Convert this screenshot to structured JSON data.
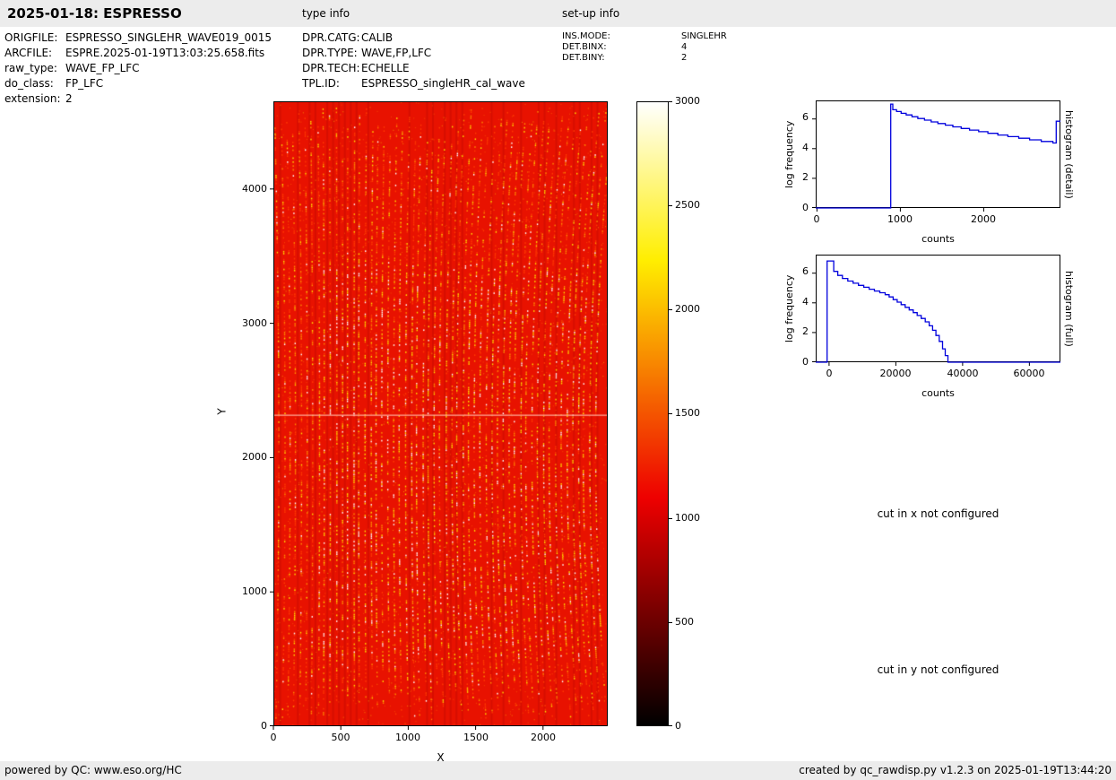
{
  "header": {
    "title": "2025-01-18: ESPRESSO",
    "type_info_label": "type info",
    "setup_info_label": "set-up info"
  },
  "file_info": {
    "rows": [
      {
        "label": "ORIGFILE:",
        "value": "ESPRESSO_SINGLEHR_WAVE019_0015"
      },
      {
        "label": "ARCFILE:",
        "value": "ESPRE.2025-01-19T13:03:25.658.fits"
      },
      {
        "label": "raw_type:",
        "value": "WAVE_FP_LFC"
      },
      {
        "label": "do_class:",
        "value": "FP_LFC"
      },
      {
        "label": "extension:",
        "value": "2"
      }
    ]
  },
  "type_info": {
    "rows": [
      {
        "label": "DPR.CATG:",
        "value": "CALIB"
      },
      {
        "label": "DPR.TYPE:",
        "value": "WAVE,FP,LFC"
      },
      {
        "label": "DPR.TECH:",
        "value": "ECHELLE"
      },
      {
        "label": "TPL.ID:",
        "value": "ESPRESSO_singleHR_cal_wave"
      }
    ]
  },
  "setup_info": {
    "rows": [
      {
        "label": "INS.MODE:",
        "value": "SINGLEHR"
      },
      {
        "label": "DET.BINX:",
        "value": "4"
      },
      {
        "label": "DET.BINY:",
        "value": "2"
      }
    ]
  },
  "annotations": {
    "cut_x": "cut in x not configured",
    "cut_y": "cut in y not configured"
  },
  "footer": {
    "left": "powered by QC: www.eso.org/HC",
    "right": "created by qc_rawdisp.py v1.2.3 on 2025-01-19T13:44:20"
  },
  "chart_data": [
    {
      "id": "raw_image",
      "type": "heatmap",
      "title": "",
      "xlabel": "X",
      "ylabel": "Y",
      "xlim": [
        0,
        2480
      ],
      "ylim": [
        0,
        4653
      ],
      "xticks": [
        0,
        500,
        1000,
        1500,
        2000
      ],
      "yticks": [
        0,
        1000,
        2000,
        3000,
        4000
      ],
      "colormap": "hot",
      "base_color": "#e81200",
      "features": {
        "background": "saturated red detector frame",
        "pattern": "dense vertical echelle-order columns of bright FP/LFC emission-line dots",
        "horizontal_line_y": 2320
      },
      "colorbar": {
        "lim": [
          0,
          3000
        ],
        "ticks": [
          0,
          500,
          1000,
          1500,
          2000,
          2500,
          3000
        ],
        "gradient_colors": [
          "#000000",
          "#ee0000",
          "#ffee00",
          "#ffffff"
        ],
        "gradient_stops_pct": [
          0,
          36.5,
          74.6,
          100
        ]
      }
    },
    {
      "id": "hist_detail",
      "type": "line",
      "line_color": "#0000dd",
      "xlabel": "counts",
      "ylabel": "log frequency",
      "right_label": "histogram (detail)",
      "xlim": [
        -15,
        2920
      ],
      "ylim": [
        0,
        7.25
      ],
      "xticks": [
        0,
        1000,
        2000
      ],
      "yticks": [
        0,
        2,
        4,
        6
      ],
      "grid": false,
      "points": [
        [
          -15,
          0
        ],
        [
          885,
          0
        ],
        [
          885,
          7.0
        ],
        [
          910,
          7.0
        ],
        [
          910,
          6.62
        ],
        [
          955,
          6.62
        ],
        [
          955,
          6.5
        ],
        [
          1010,
          6.5
        ],
        [
          1010,
          6.38
        ],
        [
          1070,
          6.38
        ],
        [
          1070,
          6.27
        ],
        [
          1140,
          6.27
        ],
        [
          1140,
          6.15
        ],
        [
          1210,
          6.15
        ],
        [
          1210,
          6.03
        ],
        [
          1290,
          6.03
        ],
        [
          1290,
          5.92
        ],
        [
          1370,
          5.92
        ],
        [
          1370,
          5.8
        ],
        [
          1450,
          5.8
        ],
        [
          1450,
          5.69
        ],
        [
          1540,
          5.69
        ],
        [
          1540,
          5.58
        ],
        [
          1630,
          5.58
        ],
        [
          1630,
          5.47
        ],
        [
          1730,
          5.47
        ],
        [
          1730,
          5.36
        ],
        [
          1830,
          5.36
        ],
        [
          1830,
          5.25
        ],
        [
          1940,
          5.25
        ],
        [
          1940,
          5.14
        ],
        [
          2050,
          5.14
        ],
        [
          2050,
          5.03
        ],
        [
          2170,
          5.03
        ],
        [
          2170,
          4.92
        ],
        [
          2290,
          4.92
        ],
        [
          2290,
          4.81
        ],
        [
          2420,
          4.81
        ],
        [
          2420,
          4.7
        ],
        [
          2550,
          4.7
        ],
        [
          2550,
          4.59
        ],
        [
          2690,
          4.59
        ],
        [
          2690,
          4.48
        ],
        [
          2830,
          4.48
        ],
        [
          2830,
          4.38
        ],
        [
          2870,
          4.38
        ],
        [
          2870,
          5.85
        ],
        [
          2920,
          5.85
        ]
      ]
    },
    {
      "id": "hist_full",
      "type": "line",
      "line_color": "#0000dd",
      "xlabel": "counts",
      "ylabel": "log frequency",
      "right_label": "histogram (full)",
      "xlim": [
        -4000,
        69300
      ],
      "ylim": [
        0,
        7.25
      ],
      "xticks": [
        0,
        20000,
        40000,
        60000
      ],
      "yticks": [
        0,
        2,
        4,
        6
      ],
      "grid": false,
      "points": [
        [
          -4000,
          0
        ],
        [
          -600,
          0
        ],
        [
          -600,
          6.82
        ],
        [
          1400,
          6.82
        ],
        [
          1400,
          6.12
        ],
        [
          2600,
          6.12
        ],
        [
          2600,
          5.85
        ],
        [
          4000,
          5.85
        ],
        [
          4000,
          5.64
        ],
        [
          5600,
          5.64
        ],
        [
          5600,
          5.47
        ],
        [
          7200,
          5.47
        ],
        [
          7200,
          5.32
        ],
        [
          8800,
          5.32
        ],
        [
          8800,
          5.18
        ],
        [
          10400,
          5.18
        ],
        [
          10400,
          5.05
        ],
        [
          12000,
          5.05
        ],
        [
          12000,
          4.92
        ],
        [
          13600,
          4.92
        ],
        [
          13600,
          4.8
        ],
        [
          15200,
          4.8
        ],
        [
          15200,
          4.68
        ],
        [
          16800,
          4.68
        ],
        [
          16800,
          4.55
        ],
        [
          18000,
          4.55
        ],
        [
          18000,
          4.4
        ],
        [
          19200,
          4.4
        ],
        [
          19200,
          4.22
        ],
        [
          20400,
          4.22
        ],
        [
          20400,
          4.05
        ],
        [
          21600,
          4.05
        ],
        [
          21600,
          3.88
        ],
        [
          22800,
          3.88
        ],
        [
          22800,
          3.7
        ],
        [
          24000,
          3.7
        ],
        [
          24000,
          3.52
        ],
        [
          25200,
          3.52
        ],
        [
          25200,
          3.34
        ],
        [
          26400,
          3.34
        ],
        [
          26400,
          3.15
        ],
        [
          27600,
          3.15
        ],
        [
          27600,
          2.95
        ],
        [
          28800,
          2.95
        ],
        [
          28800,
          2.72
        ],
        [
          30000,
          2.72
        ],
        [
          30000,
          2.45
        ],
        [
          31000,
          2.45
        ],
        [
          31000,
          2.15
        ],
        [
          32000,
          2.15
        ],
        [
          32000,
          1.8
        ],
        [
          33000,
          1.8
        ],
        [
          33000,
          1.4
        ],
        [
          34000,
          1.4
        ],
        [
          34000,
          0.9
        ],
        [
          34800,
          0.9
        ],
        [
          34800,
          0.45
        ],
        [
          35600,
          0.45
        ],
        [
          35600,
          0
        ],
        [
          69300,
          0
        ]
      ]
    }
  ]
}
